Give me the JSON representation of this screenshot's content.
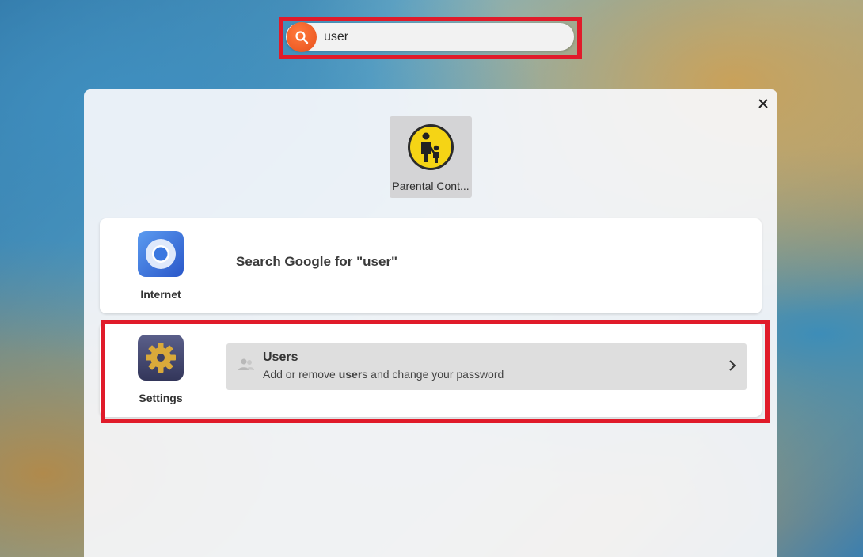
{
  "search": {
    "value": "user"
  },
  "app_tile": {
    "label": "Parental Cont..."
  },
  "internet": {
    "provider_label": "Internet",
    "result_text": "Search Google for \"user\""
  },
  "settings": {
    "provider_label": "Settings",
    "result": {
      "title": "Users",
      "desc_before": "Add or remove ",
      "desc_bold": "user",
      "desc_after": "s and change your password"
    }
  },
  "icons": [
    "search-icon",
    "close-icon",
    "parental-controls-icon",
    "chromium-icon",
    "settings-gear-icon",
    "users-icon",
    "chevron-right-icon"
  ],
  "colors": {
    "highlight": "#e01b2a",
    "search_accent": "#e8501c"
  }
}
